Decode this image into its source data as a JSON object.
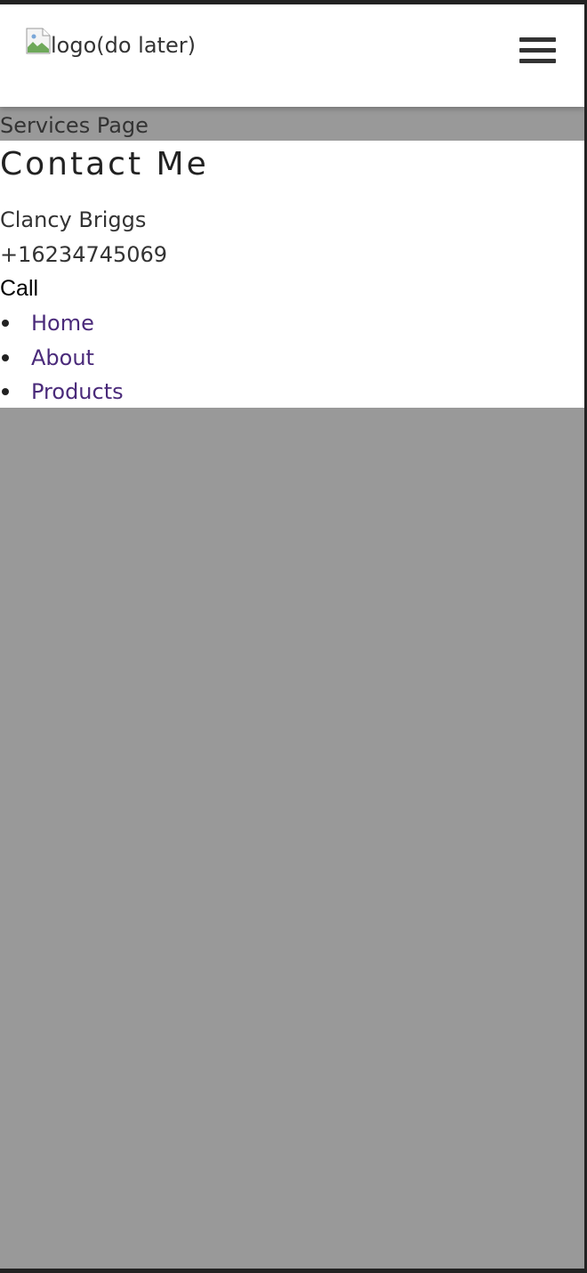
{
  "header": {
    "logo_alt": "logo(do later)",
    "menu_icon": "hamburger-menu-icon"
  },
  "banner": {
    "page_label": "Services Page"
  },
  "contact": {
    "title": "Contact Me",
    "name": "Clancy Briggs",
    "phone": "+16234745069",
    "call_label": "Call"
  },
  "nav": {
    "items": [
      {
        "label": "Home"
      },
      {
        "label": "About"
      },
      {
        "label": "Products"
      }
    ]
  },
  "colors": {
    "link": "#4a2a7a",
    "page_background": "#999999",
    "panel_background": "#ffffff",
    "text": "#333333"
  }
}
